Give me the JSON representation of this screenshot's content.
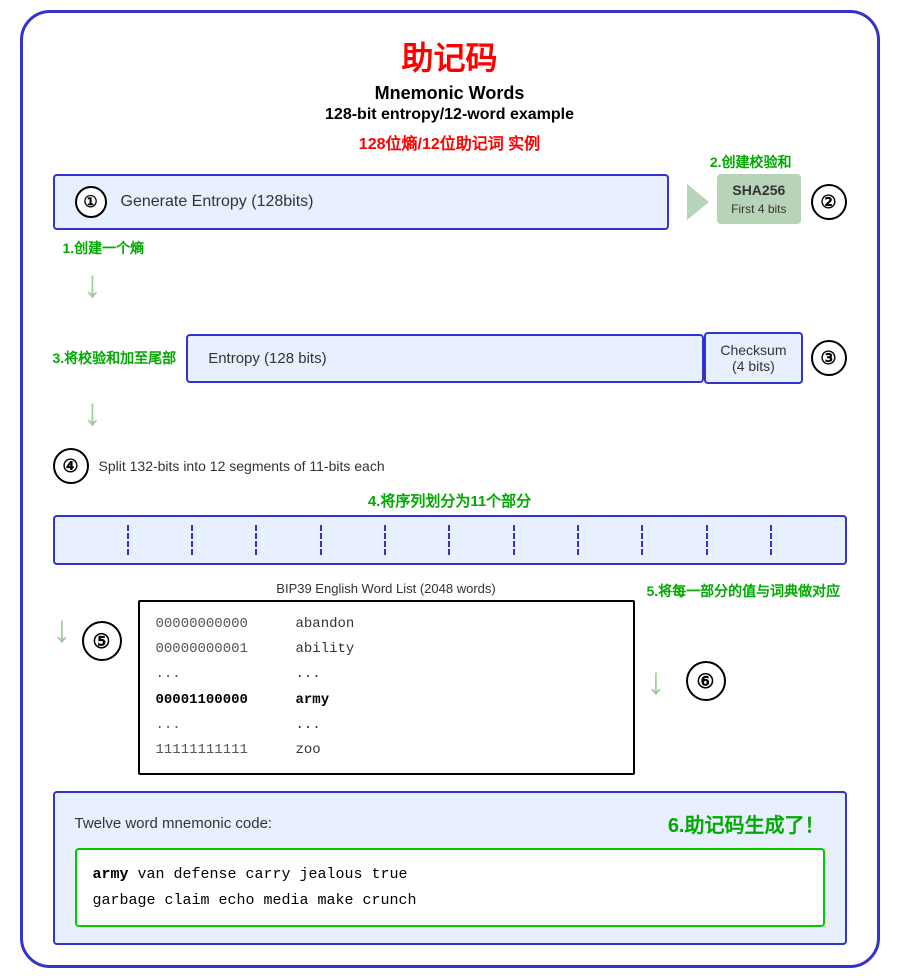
{
  "title": {
    "cn": "助记码",
    "en_main": "Mnemonic Words",
    "en_sub": "128-bit entropy/12-word example",
    "cn_sub": "128位熵/12位助记词 实例"
  },
  "labels": {
    "label1": "1.创建一个熵",
    "label2": "2.创建校验和",
    "label3": "3.将校验和加至尾部",
    "label4": "4.将序列划分为11个部分",
    "label5": "5.将每一部分的值与词典做对应",
    "label6": "6.助记码生成了！"
  },
  "section1": {
    "circle": "①",
    "text": "Generate Entropy (128bits)"
  },
  "section2": {
    "circle": "②",
    "sha": "SHA256",
    "sub": "First 4 bits"
  },
  "section3": {
    "circle": "③",
    "entropy_label": "Entropy (128 bits)",
    "checksum_label": "Checksum\n(4 bits)"
  },
  "section4": {
    "circle": "④",
    "text": "Split 132-bits into 12 segments of 11-bits each"
  },
  "section5": {
    "circle": "⑤",
    "wordlist_title": "BIP39 English Word List (2048 words)",
    "rows": [
      {
        "num": "00000000000",
        "word": "abandon"
      },
      {
        "num": "00000000001",
        "word": "ability"
      },
      {
        "num": "...",
        "word": "..."
      },
      {
        "num": "00001100000",
        "word": "army",
        "bold": true
      },
      {
        "num": "...",
        "word": "..."
      },
      {
        "num": "11111111111",
        "word": "zoo"
      }
    ]
  },
  "section6": {
    "circle": "⑥",
    "title": "Twelve word mnemonic code:",
    "mnemonic": "army van defense carry jealous true garbage claim echo media make crunch",
    "mnemonic_first": "army",
    "mnemonic_rest": " van defense carry jealous true\ngarbage claim echo media make crunch"
  }
}
